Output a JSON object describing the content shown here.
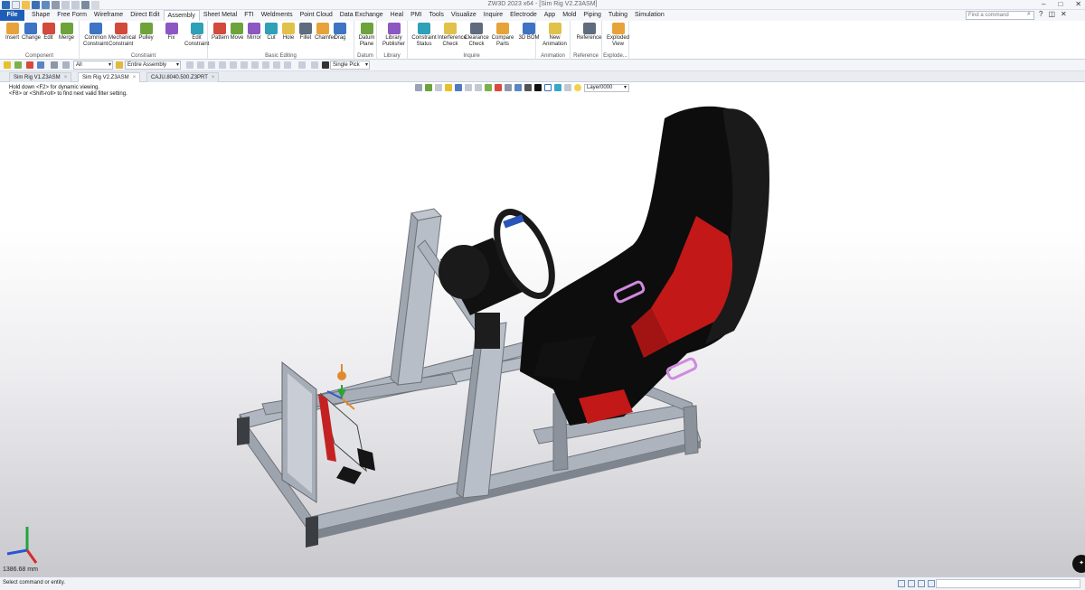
{
  "window": {
    "title": "ZW3D 2023 x64 - [Sim Rig V2.Z3ASM]"
  },
  "menu": {
    "file": "File",
    "tabs": [
      "Shape",
      "Free Form",
      "Wireframe",
      "Direct Edit",
      "Assembly",
      "Sheet Metal",
      "FTI",
      "Weldments",
      "Point Cloud",
      "Data Exchange",
      "Heal",
      "PMI",
      "Tools",
      "Visualize",
      "Inquire",
      "Electrode",
      "App",
      "Mold",
      "Piping",
      "Tubing",
      "Simulation"
    ],
    "active_tab": "Assembly",
    "search_placeholder": "Find a command"
  },
  "ribbon": {
    "groups": [
      {
        "name": "Component",
        "buttons": [
          "Insert",
          "Change",
          "Edit",
          "Merge"
        ]
      },
      {
        "name": "Constraint",
        "buttons": [
          "Common Constraint",
          "Mechanical Constraint",
          "Pulley",
          "Fix",
          "Edit Constraint"
        ]
      },
      {
        "name": "Basic Editing",
        "buttons": [
          "Pattern",
          "Move",
          "Mirror",
          "Cut",
          "Hole",
          "Fillet",
          "Chamfer",
          "Drag"
        ]
      },
      {
        "name": "Datum",
        "buttons": [
          "Datum Plane"
        ]
      },
      {
        "name": "Library",
        "buttons": [
          "Library Publisher"
        ]
      },
      {
        "name": "Inquire",
        "buttons": [
          "Constraint Status",
          "Interference Check",
          "Clearance Check",
          "Compare Parts",
          "3D BOM"
        ]
      },
      {
        "name": "Animation",
        "buttons": [
          "New Animation"
        ]
      },
      {
        "name": "Reference",
        "buttons": [
          "Reference"
        ]
      },
      {
        "name": "Explode...",
        "buttons": [
          "Exploded View"
        ]
      }
    ]
  },
  "filterbar": {
    "filter_value": "All",
    "scope_value": "Entire Assembly",
    "pick_mode": "Single Pick"
  },
  "doc_tabs": [
    {
      "label": "Sim Rig V1.Z3ASM",
      "active": false
    },
    {
      "label": "Sim Rig V2.Z3ASM",
      "active": true
    },
    {
      "label": "CAJU.8040.500.Z3PRT",
      "active": false
    }
  ],
  "viewport": {
    "hint_line1": "Hold down <F2> for dynamic viewing.",
    "hint_line2": "<F8> or <Shift-roll> to find next valid filter setting.",
    "layer": "Layer0000",
    "scale_readout": "1386.68 mm",
    "colors": {
      "frame": "#9aa1ab",
      "seat": "#0b0b0b",
      "seat_cushion": "#c01818",
      "accent_purple": "#d08ae0"
    }
  },
  "status": {
    "message": "Select command or entity."
  }
}
